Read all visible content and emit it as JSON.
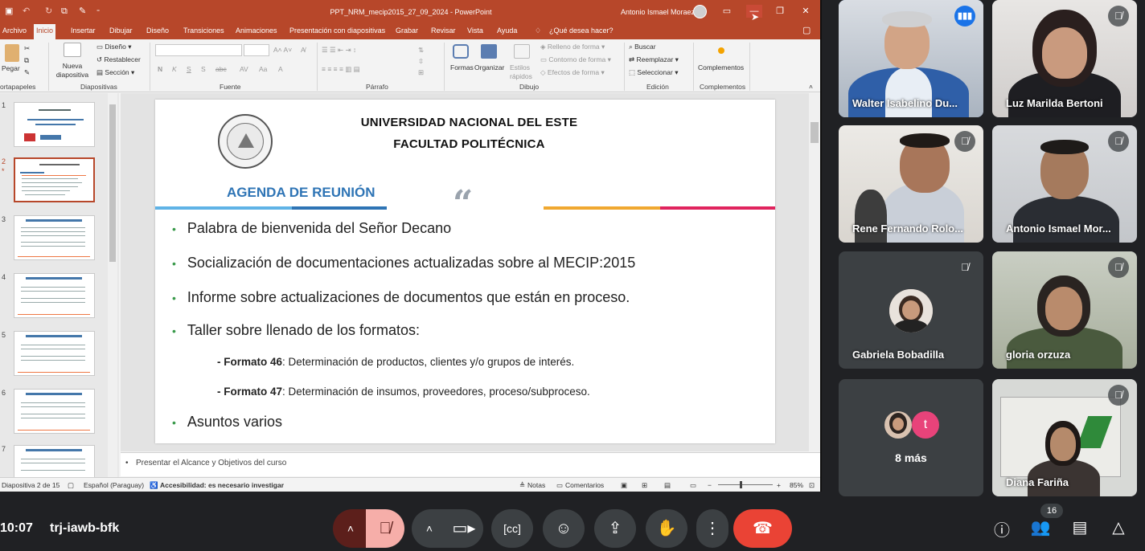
{
  "ppt": {
    "doc_title": "PPT_NRM_mecip2015_27_09_2024  -  PowerPoint",
    "user": "Antonio Ismael Moraez",
    "tabs": [
      "Archivo",
      "Inicio",
      "Insertar",
      "Dibujar",
      "Diseño",
      "Transiciones",
      "Animaciones",
      "Presentación con diapositivas",
      "Grabar",
      "Revisar",
      "Vista",
      "Ayuda",
      "¿Qué desea hacer?"
    ],
    "ribbon": {
      "paste": "Pegar",
      "clipboard": "ortapapeles",
      "new_slide": "Nueva diapositiva",
      "layout": "Diseño",
      "reset": "Restablecer",
      "section": "Sección",
      "slides_group": "Diapositivas",
      "font_group": "Fuente",
      "paragraph_group": "Párrafo",
      "shapes": "Formas",
      "arrange": "Organizar",
      "styles": "Estilos rápidos",
      "fill": "Relleno de forma",
      "outline": "Contorno de forma",
      "effects": "Efectos de forma",
      "drawing_group": "Dibujo",
      "find": "Buscar",
      "replace": "Reemplazar",
      "select": "Seleccionar",
      "editing_group": "Edición",
      "addins": "Complementos",
      "addins_group": "Complementos"
    },
    "slide_numbers": [
      "1",
      "2",
      "3",
      "4",
      "5",
      "6",
      "7"
    ],
    "slide": {
      "university": "UNIVERSIDAD NACIONAL DEL ESTE",
      "faculty": "FACULTAD POLITÉCNICA",
      "agenda_title": "AGENDA DE REUNIÓN",
      "quote_mark": "“",
      "bullets": [
        "Palabra de bienvenida del Señor Decano",
        "Socialización de documentaciones actualizadas sobre al MECIP:2015",
        "Informe sobre actualizaciones de documentos que están en proceso.",
        "Taller sobre llenado de los formatos:",
        "Asuntos varios"
      ],
      "sub_items": [
        {
          "label": "- Formato 46",
          "text": ": Determinación de productos, clientes y/o grupos de interés."
        },
        {
          "label": "- Formato 47",
          "text": ": Determinación de insumos, proveedores, proceso/subproceso."
        }
      ]
    },
    "notes": "Presentar el Alcance y Objetivos del curso",
    "status": {
      "slide_of": "Diapositiva 2 de 15",
      "language": "Español (Paraguay)",
      "accessibility": "Accesibilidad: es necesario investigar",
      "notes_btn": "Notas",
      "comments_btn": "Comentarios",
      "zoom": "85%"
    },
    "colors": {
      "accent": "#b7472a",
      "agenda_blue": "#2e74b5"
    }
  },
  "participants": [
    {
      "name": "Walter Isabelino Du...",
      "speaking": true
    },
    {
      "name": "Luz Marilda Bertoni",
      "muted": true
    },
    {
      "name": "Rene Fernando Rolo...",
      "muted": true
    },
    {
      "name": "Antonio Ismael Mor...",
      "muted": true
    },
    {
      "name": "Gabriela Bobadilla",
      "muted": true
    },
    {
      "name": "gloria orzuza",
      "muted": true
    },
    {
      "name": "8 más",
      "avatar_letter": "t"
    },
    {
      "name": "Diana Fariña",
      "muted": true
    }
  ],
  "call": {
    "time": "10:07",
    "meeting_code": "trj-iawb-bfk",
    "participant_count": "16"
  }
}
